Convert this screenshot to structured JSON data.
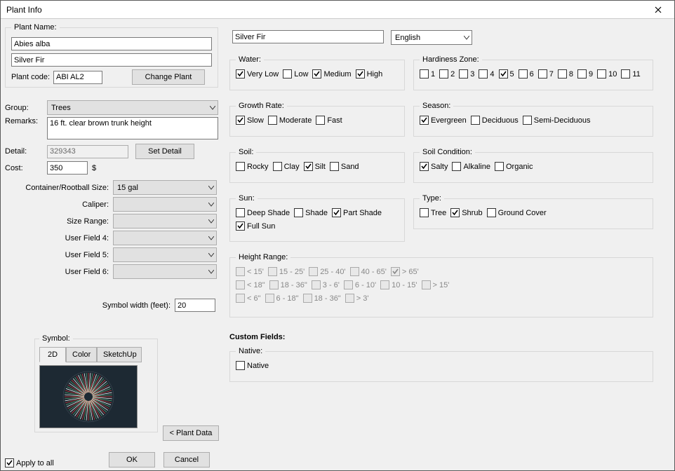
{
  "window": {
    "title": "Plant Info"
  },
  "plantname": {
    "legend": "Plant Name:",
    "latin": "Abies alba",
    "common": "Silver Fir",
    "code_lbl": "Plant code:",
    "code": "ABI AL2",
    "change_btn": "Change Plant"
  },
  "left": {
    "group_lbl": "Group:",
    "group_val": "Trees",
    "remarks_lbl": "Remarks:",
    "remarks_val": "16 ft. clear brown trunk height",
    "detail_lbl": "Detail:",
    "detail_val": "329343",
    "setdetail_btn": "Set Detail",
    "cost_lbl": "Cost:",
    "cost_val": "350",
    "cost_unit": "$",
    "size_lbl": "Container/Rootball Size:",
    "size_val": "15 gal",
    "caliper_lbl": "Caliper:",
    "range_lbl": "Size Range:",
    "uf4_lbl": "User Field 4:",
    "uf5_lbl": "User Field 5:",
    "uf6_lbl": "User Field 6:",
    "symwidth_lbl": "Symbol width (feet):",
    "symwidth_val": "20",
    "symbol_legend": "Symbol:",
    "tab_2d": "2D",
    "tab_color": "Color",
    "tab_sk": "SketchUp",
    "plantdata_btn": "< Plant Data",
    "apply_lbl": "Apply to all",
    "ok_btn": "OK",
    "cancel_btn": "Cancel"
  },
  "top": {
    "name_val": "Silver Fir",
    "lang_val": "English"
  },
  "water": {
    "legend": "Water:",
    "opts": [
      {
        "lbl": "Very Low",
        "chk": true
      },
      {
        "lbl": "Low",
        "chk": false
      },
      {
        "lbl": "Medium",
        "chk": true
      },
      {
        "lbl": "High",
        "chk": true
      }
    ]
  },
  "hardiness": {
    "legend": "Hardiness Zone:",
    "opts": [
      {
        "lbl": "1"
      },
      {
        "lbl": "2"
      },
      {
        "lbl": "3"
      },
      {
        "lbl": "4"
      },
      {
        "lbl": "5",
        "chk": true
      },
      {
        "lbl": "6"
      },
      {
        "lbl": "7"
      },
      {
        "lbl": "8"
      },
      {
        "lbl": "9"
      },
      {
        "lbl": "10"
      },
      {
        "lbl": "11"
      }
    ]
  },
  "growth": {
    "legend": "Growth Rate:",
    "opts": [
      {
        "lbl": "Slow",
        "chk": true
      },
      {
        "lbl": "Moderate"
      },
      {
        "lbl": "Fast"
      }
    ]
  },
  "season": {
    "legend": "Season:",
    "opts": [
      {
        "lbl": "Evergreen",
        "chk": true
      },
      {
        "lbl": "Deciduous"
      },
      {
        "lbl": "Semi-Deciduous"
      }
    ]
  },
  "soil": {
    "legend": "Soil:",
    "opts": [
      {
        "lbl": "Rocky"
      },
      {
        "lbl": "Clay"
      },
      {
        "lbl": "Silt",
        "chk": true
      },
      {
        "lbl": "Sand"
      }
    ]
  },
  "soilcond": {
    "legend": "Soil Condition:",
    "opts": [
      {
        "lbl": "Salty",
        "chk": true
      },
      {
        "lbl": "Alkaline"
      },
      {
        "lbl": "Organic"
      }
    ]
  },
  "sun": {
    "legend": "Sun:",
    "opts": [
      {
        "lbl": "Deep Shade"
      },
      {
        "lbl": "Shade"
      },
      {
        "lbl": "Part Shade",
        "chk": true
      },
      {
        "lbl": "Full Sun",
        "chk": true
      }
    ]
  },
  "type": {
    "legend": "Type:",
    "opts": [
      {
        "lbl": "Tree"
      },
      {
        "lbl": "Shrub",
        "chk": true
      },
      {
        "lbl": "Ground Cover"
      }
    ]
  },
  "height": {
    "legend": "Height Range:",
    "rows": [
      [
        {
          "lbl": "< 15'",
          "dis": true
        },
        {
          "lbl": "15 - 25'",
          "dis": true
        },
        {
          "lbl": "25 - 40'",
          "dis": true
        },
        {
          "lbl": "40 - 65'",
          "dis": true
        },
        {
          "lbl": "> 65'",
          "chk": true,
          "dis": true
        }
      ],
      [
        {
          "lbl": "< 18\"",
          "dis": true
        },
        {
          "lbl": "18 - 36\"",
          "dis": true
        },
        {
          "lbl": "3 - 6'",
          "dis": true
        },
        {
          "lbl": "6 - 10'",
          "dis": true
        },
        {
          "lbl": "10 - 15'",
          "dis": true
        },
        {
          "lbl": "> 15'",
          "dis": true
        }
      ],
      [
        {
          "lbl": "< 6\"",
          "dis": true
        },
        {
          "lbl": "6 - 18\"",
          "dis": true
        },
        {
          "lbl": "18 - 36\"",
          "dis": true
        },
        {
          "lbl": "> 3'",
          "dis": true
        }
      ]
    ]
  },
  "custom": {
    "heading": "Custom Fields:",
    "native_legend": "Native:",
    "native_lbl": "Native"
  }
}
